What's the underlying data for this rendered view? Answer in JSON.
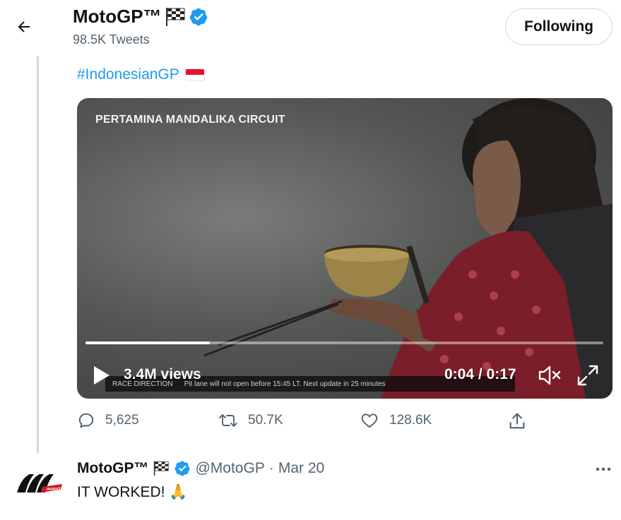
{
  "header": {
    "name": "MotoGP™",
    "tweet_count": "98.5K Tweets",
    "follow_button": "Following"
  },
  "tweet": {
    "hashtag": "#IndonesianGP",
    "video": {
      "caption": "PERTAMINA MANDALIKA CIRCUIT",
      "lower_third_left": "RACE DIRECTION",
      "lower_third_right": "Pit lane will not open before 15:45 LT. Next update in 25 minutes",
      "views": "3.4M views",
      "time": "0:04 / 0:17",
      "progress_fraction": 0.24
    },
    "actions": {
      "replies": "5,625",
      "retweets": "50.7K",
      "likes": "128.6K"
    }
  },
  "reply": {
    "name": "MotoGP™",
    "handle": "@MotoGP",
    "separator": "·",
    "date": "Mar 20",
    "text": "IT WORKED!",
    "emoji": "🙏"
  },
  "colors": {
    "accent": "#1d9bf0",
    "secondary_text": "#536471",
    "border": "#cfd9de"
  }
}
